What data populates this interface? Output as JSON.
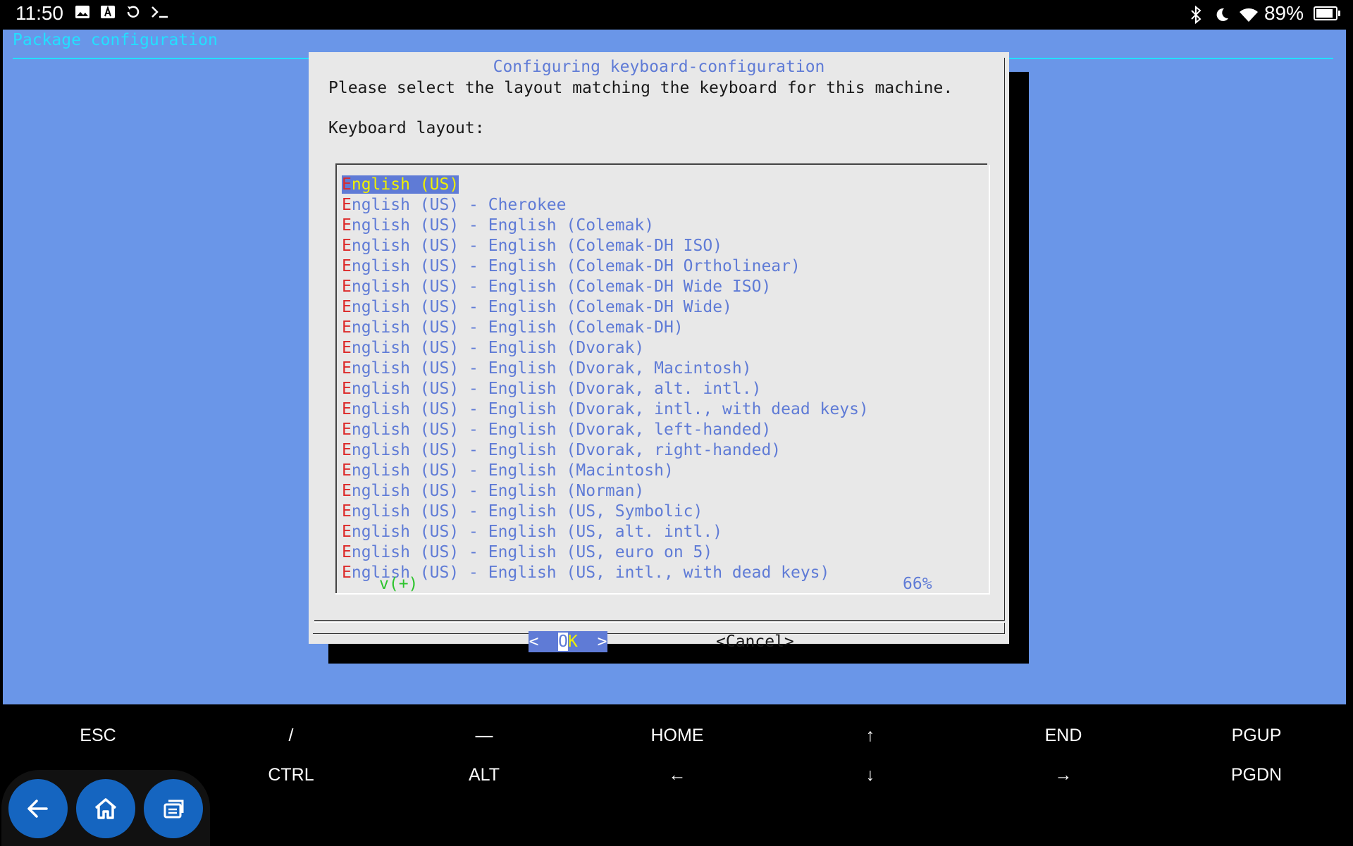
{
  "status_bar": {
    "time": "11:50",
    "battery": "89%",
    "battery_level": 0.89,
    "left_icons": [
      "image-icon",
      "text-a-icon",
      "sync-icon",
      "terminal-icon"
    ],
    "right_icons": [
      "bluetooth-icon",
      "moon-icon",
      "wifi-icon",
      "battery-icon"
    ]
  },
  "terminal": {
    "header": "Package configuration",
    "dialog": {
      "title": "Configuring keyboard-configuration",
      "prompt": "Please select the layout matching the keyboard for this machine.",
      "list_label": "Keyboard layout:",
      "items": [
        "English (US)",
        "English (US) - Cherokee",
        "English (US) - English (Colemak)",
        "English (US) - English (Colemak-DH ISO)",
        "English (US) - English (Colemak-DH Ortholinear)",
        "English (US) - English (Colemak-DH Wide ISO)",
        "English (US) - English (Colemak-DH Wide)",
        "English (US) - English (Colemak-DH)",
        "English (US) - English (Dvorak)",
        "English (US) - English (Dvorak, Macintosh)",
        "English (US) - English (Dvorak, alt. intl.)",
        "English (US) - English (Dvorak, intl., with dead keys)",
        "English (US) - English (Dvorak, left-handed)",
        "English (US) - English (Dvorak, right-handed)",
        "English (US) - English (Macintosh)",
        "English (US) - English (Norman)",
        "English (US) - English (US, Symbolic)",
        "English (US) - English (US, alt. intl.)",
        "English (US) - English (US, euro on 5)",
        "English (US) - English (US, intl., with dead keys)"
      ],
      "selected_index": 0,
      "scroll_indicator": "v(+)",
      "scroll_percent": "66%",
      "ok_button": {
        "left": "<",
        "cursor": "O",
        "hotkey": "K",
        "right": ">"
      },
      "cancel_button": "<Cancel>"
    }
  },
  "extra_keys": {
    "row1": [
      "ESC",
      "/",
      "—",
      "HOME",
      "↑",
      "END",
      "PGUP"
    ],
    "row2": [
      "",
      "CTRL",
      "ALT",
      "←",
      "↓",
      "→",
      "PGDN"
    ]
  },
  "nav_bar": {
    "buttons": [
      "back-arrow-icon",
      "home-icon",
      "recent-apps-icon"
    ]
  },
  "colors": {
    "terminal_bg": "#6a96e8",
    "dialog_bg": "#e8e8e8",
    "item_text": "#5f7bd6",
    "hotkey": "#dc2a2a",
    "header_cyan": "#22e0ff",
    "nav_button": "#1565c0"
  }
}
